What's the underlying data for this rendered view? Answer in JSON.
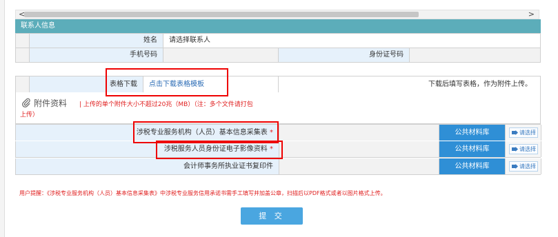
{
  "contact_section": {
    "header": "联系人信息",
    "name_label": "姓名",
    "name_value": "请选择联系人",
    "phone_label": "手机号码",
    "phone_value": "",
    "id_label": "身份证号码",
    "id_value": ""
  },
  "template_row": {
    "label": "表格下载",
    "link": "点击下载表格模板",
    "note": "下载后填写表格，作为附件上传。"
  },
  "attachments": {
    "title": "附件资料",
    "note_line1": "| 上传的单个附件大小不超过20兆（MB）（注：多个文件请打包",
    "note_line2": "上传）",
    "library_label": "公共材料库",
    "select_label": "请选择",
    "required_mark": "*",
    "items": [
      {
        "label": "涉税专业服务机构（人员）基本信息采集表"
      },
      {
        "label": "涉税服务人员身份证电子影像资料"
      },
      {
        "label": "会计师事务所执业证书复印件"
      }
    ]
  },
  "hint": "用户提醒：《涉税专业服务机构（人员）基本信息采集表》中涉税专业服务信用承诺书需手工填写并加盖公章，扫描后以PDF格式或者以图片格式上传。",
  "submit_label": "提 交",
  "scroll": {
    "left_arrow": "<",
    "right_arrow": ">"
  },
  "colors": {
    "header": "#5cadba",
    "label_bg": "#e6f1fb",
    "library_btn": "#2f8fd6",
    "submit_btn": "#4aa6e0",
    "alert": "#e02020",
    "highlight": "#e00000"
  }
}
